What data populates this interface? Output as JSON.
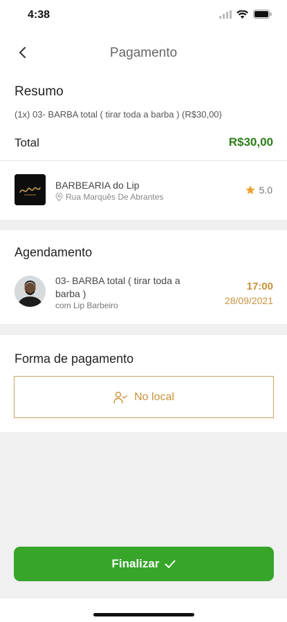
{
  "status": {
    "time": "4:38"
  },
  "nav": {
    "title": "Pagamento"
  },
  "resumo": {
    "title": "Resumo",
    "item": "(1x) 03- BARBA total ( tirar toda a barba ) (R$30,00)",
    "total_label": "Total",
    "total_value": "R$30,00"
  },
  "shop": {
    "name": "BARBEARIA do Lip",
    "address": "Rua Marquês De Abrantes",
    "rating": "5.0"
  },
  "agendamento": {
    "title": "Agendamento",
    "service": "03- BARBA total ( tirar toda a barba )",
    "professional": "com Lip Barbeiro",
    "time": "17:00",
    "date": "28/09/2021"
  },
  "pagamento": {
    "title": "Forma de pagamento",
    "option": "No local"
  },
  "actions": {
    "finish_label": "Finalizar"
  },
  "colors": {
    "total_green": "#2e7d19",
    "accent_gold": "#c9923a",
    "button_green": "#36a52a",
    "star": "#f0a030"
  }
}
